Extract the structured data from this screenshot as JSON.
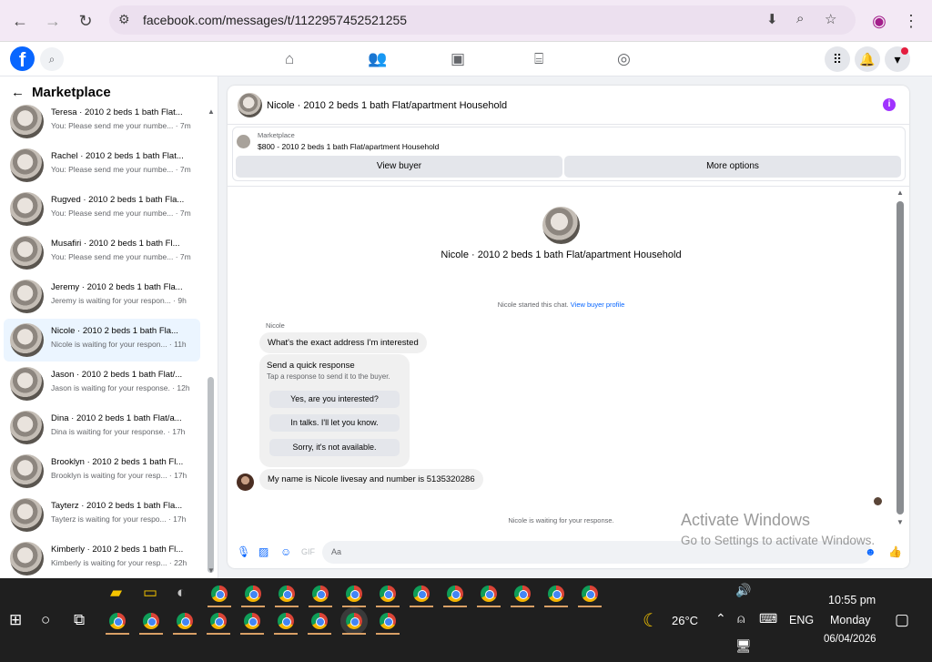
{
  "browser": {
    "url": "facebook.com/messages/t/1122957452521255"
  },
  "sidebar": {
    "title": "Marketplace",
    "conversations": [
      {
        "name": "Teresa · 2010 2 beds 1 bath Flat...",
        "snippet": "You: Please send me your numbe... · 7m"
      },
      {
        "name": "Rachel · 2010 2 beds 1 bath Flat...",
        "snippet": "You: Please send me your numbe... · 7m"
      },
      {
        "name": "Rugved · 2010 2 beds 1 bath Fla...",
        "snippet": "You: Please send me your numbe... · 7m"
      },
      {
        "name": "Musafiri · 2010 2 beds 1 bath Fl...",
        "snippet": "You: Please send me your numbe... · 7m"
      },
      {
        "name": "Jeremy · 2010 2 beds 1 bath Fla...",
        "snippet": "Jeremy is waiting for your respon... · 9h"
      },
      {
        "name": "Nicole · 2010 2 beds 1 bath Fla...",
        "snippet": "Nicole is waiting for your respon... · 11h"
      },
      {
        "name": "Jason · 2010 2 beds 1 bath Flat/...",
        "snippet": "Jason is waiting for your response. · 12h"
      },
      {
        "name": "Dina · 2010 2 beds 1 bath Flat/a...",
        "snippet": "Dina is waiting for your response. · 17h"
      },
      {
        "name": "Brooklyn · 2010 2 beds 1 bath Fl...",
        "snippet": "Brooklyn is waiting for your resp... · 17h"
      },
      {
        "name": "Tayterz · 2010 2 beds 1 bath Fla...",
        "snippet": "Tayterz is waiting for your respo... · 17h"
      },
      {
        "name": "Kimberly · 2010 2 beds 1 bath Fl...",
        "snippet": "Kimberly is waiting for your resp... · 22h"
      }
    ]
  },
  "chat": {
    "title": "Nicole · 2010 2 beds 1 bath Flat/apartment Household",
    "listing_label": "Marketplace",
    "listing_price": "$800 - 2010 2 beds 1 bath Flat/apartment Household",
    "view_buyer": "View buyer",
    "more_options": "More options",
    "center_name": "Nicole · 2010 2 beds 1 bath Flat/apartment Household",
    "started_text": "Nicole started this chat.",
    "view_profile": "View buyer profile",
    "sender_label": "Nicole",
    "msg1": "What's the exact address I'm interested",
    "quick_title": "Send a quick response",
    "quick_sub": "Tap a response to send it to the buyer.",
    "quick_options": [
      "Yes, are you interested?",
      "In talks. I'll let you know.",
      "Sorry, it's not available."
    ],
    "msg2": "My name is Nicole livesay and number is 5135320286",
    "waiting": "Nicole is waiting for your response.",
    "placeholder": "Aa"
  },
  "watermark": {
    "line1": "Activate Windows",
    "line2": "Go to Settings to activate Windows."
  },
  "taskbar": {
    "temperature": "26°C",
    "language": "ENG",
    "time": "10:55 pm",
    "day": "Monday",
    "date": "06/04/2026"
  }
}
